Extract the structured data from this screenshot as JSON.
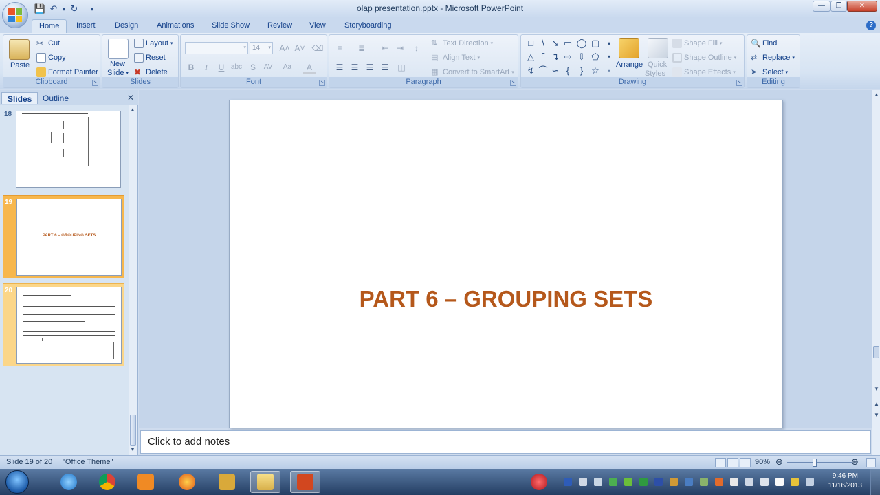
{
  "window": {
    "title": "olap presentation.pptx - Microsoft PowerPoint"
  },
  "qat": {
    "save": "save-icon",
    "undo": "undo-icon",
    "redo": "redo-icon",
    "customize": "dropdown-icon"
  },
  "tabs": [
    "Home",
    "Insert",
    "Design",
    "Animations",
    "Slide Show",
    "Review",
    "View",
    "Storyboarding"
  ],
  "ribbon": {
    "clipboard": {
      "label": "Clipboard",
      "paste": "Paste",
      "cut": "Cut",
      "copy": "Copy",
      "format_painter": "Format Painter"
    },
    "slides": {
      "label": "Slides",
      "new_slide_1": "New",
      "new_slide_2": "Slide",
      "layout": "Layout",
      "reset": "Reset",
      "delete": "Delete"
    },
    "font": {
      "label": "Font",
      "font_size": "14"
    },
    "paragraph": {
      "label": "Paragraph",
      "text_direction": "Text Direction",
      "align_text": "Align Text",
      "convert_smartart": "Convert to SmartArt"
    },
    "drawing": {
      "label": "Drawing",
      "arrange": "Arrange",
      "quick_styles_1": "Quick",
      "quick_styles_2": "Styles",
      "shape_fill": "Shape Fill",
      "shape_outline": "Shape Outline",
      "shape_effects": "Shape Effects"
    },
    "editing": {
      "label": "Editing",
      "find": "Find",
      "replace": "Replace",
      "select": "Select"
    }
  },
  "panel": {
    "tabs": [
      "Slides",
      "Outline"
    ],
    "thumbnails": [
      {
        "number": "18",
        "title": ""
      },
      {
        "number": "19",
        "title": "PART 6 – GROUPING SETS"
      },
      {
        "number": "20",
        "title": ""
      }
    ]
  },
  "slide": {
    "title": "PART 6 – GROUPING SETS"
  },
  "notes": {
    "placeholder": "Click to add notes"
  },
  "status": {
    "slide_info": "Slide 19 of 20",
    "theme": "\"Office Theme\"",
    "zoom": "90%"
  },
  "clock": {
    "time": "9:46 PM",
    "date": "11/16/2013"
  },
  "colors": {
    "title_accent": "#b5581b",
    "selected_thumb": "#f7b74d",
    "ribbon_text": "#15428b"
  }
}
